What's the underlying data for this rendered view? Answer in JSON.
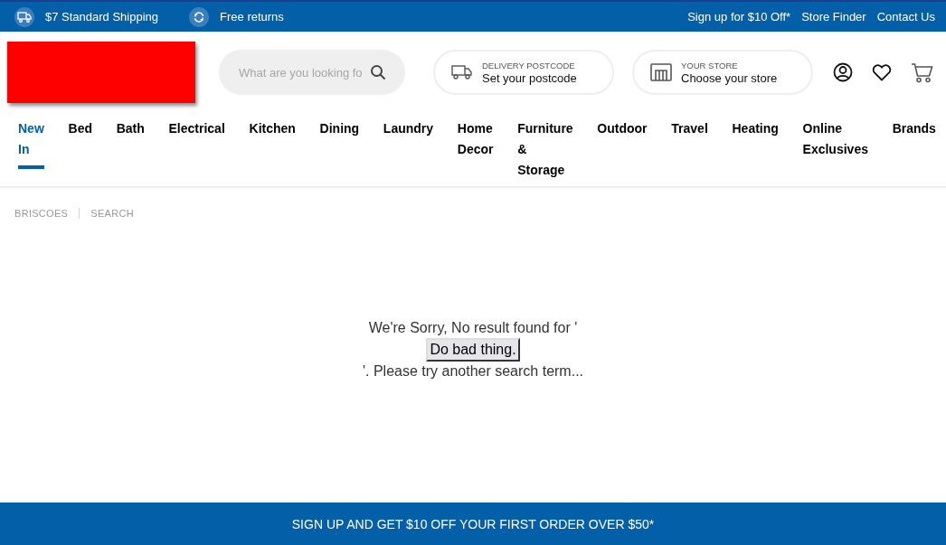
{
  "top_bar": {
    "left": [
      {
        "kind": "truck",
        "label": "$7 Standard Shipping"
      },
      {
        "kind": "returns",
        "label": "Free returns"
      }
    ],
    "links": [
      "Sign up for $10 Off*",
      "Store Finder",
      "Contact Us"
    ]
  },
  "header": {
    "search": {
      "placeholder": "What are you looking fo"
    },
    "delivery": {
      "caption": "DELIVERY POSTCODE",
      "value": "Set your postcode"
    },
    "store": {
      "caption": "YOUR STORE",
      "value": "Choose your store"
    }
  },
  "nav": [
    {
      "label": "New In",
      "selected": true
    },
    {
      "label": "Bed",
      "selected": false
    },
    {
      "label": "Bath",
      "selected": false
    },
    {
      "label": "Electrical",
      "selected": false
    },
    {
      "label": "Kitchen",
      "selected": false
    },
    {
      "label": "Dining",
      "selected": false
    },
    {
      "label": "Laundry",
      "selected": false
    },
    {
      "label": "Home Decor",
      "selected": false
    },
    {
      "label": "Furniture & Storage",
      "selected": false
    },
    {
      "label": "Outdoor",
      "selected": false
    },
    {
      "label": "Travel",
      "selected": false
    },
    {
      "label": "Heating",
      "selected": false
    },
    {
      "label": "Online Exclusives",
      "selected": false
    },
    {
      "label": "Brands",
      "selected": false
    }
  ],
  "breadcrumb": [
    "BRISCOES",
    "SEARCH"
  ],
  "message": {
    "before": "We're Sorry, No result found for '",
    "button": "Do bad thing.",
    "after": "'. Please try another search term..."
  },
  "footer_banner": "SIGN UP AND GET $10 OFF YOUR FIRST ORDER OVER $50*"
}
